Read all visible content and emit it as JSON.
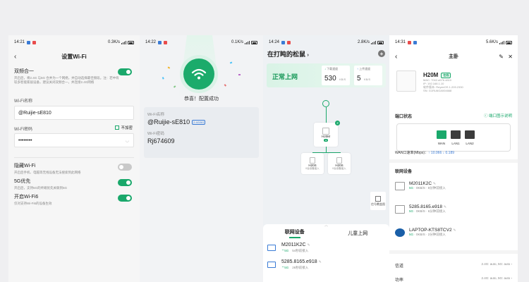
{
  "panel1": {
    "status": {
      "time": "14:21",
      "speed": "0.3K/s",
      "battery": "77"
    },
    "title": "设置Wi-Fi",
    "dualband": {
      "label": "双频合一",
      "desc": "开启后，将2.4G 与5G 合并为一个网络，并自动选择最佳频段。注：若中有较多智能家居设备，建议关闭双频合一，并连接2.4G网络",
      "on": true
    },
    "wifiname_label": "Wi-Fi名称",
    "wifiname_value": "@Ruijie-sE810",
    "password_label": "Wi-Fi密码",
    "hide_password_label": "不加密",
    "password_value": "••••••••",
    "hidden": {
      "label": "隐藏Wi-Fi",
      "desc": "开启后手机、电脑等无线设备无法搜索到此网络",
      "on": false
    },
    "fiveg": {
      "label": "5G优先",
      "desc": "开启后，支持5G的终端优先关联到5G",
      "on": true
    },
    "wifi6": {
      "label": "开启Wi-Fi6",
      "desc": "仅对支持Wi-Fi6的设备生效",
      "on": true
    }
  },
  "panel2": {
    "status": {
      "time": "14:22",
      "speed": "0.1K/s",
      "battery": "77"
    },
    "success_text": "恭喜！配置成功",
    "name_label": "Wi-Fi名称",
    "name_value": "@Ruijie-sE810",
    "band_tag": "2.4G/5G",
    "pwd_label": "Wi-Fi密码",
    "pwd_value": "Rj674609"
  },
  "panel3": {
    "status": {
      "time": "14:24",
      "speed": "2.8K/s",
      "battery": "77"
    },
    "title": "在打盹的松鼠",
    "net_status": "正常上网",
    "down_label": "下载速度",
    "down_value": "530",
    "down_unit": "KB/S",
    "up_label": "上传速度",
    "up_value": "5",
    "up_unit": "KB/S",
    "main_node": "H20M",
    "main_badge": "2",
    "node1": "H20S",
    "node1_sub": "0台设备接入",
    "node2": "H20S",
    "node2_sub": "0台设备接入",
    "ota_label": "信号覆盖图",
    "tab_active": "联网设备",
    "tab_other": "儿童上网",
    "devices": [
      {
        "name": "M2011K2C",
        "band": "5G",
        "meta": "54秒前接入"
      },
      {
        "name": "5285.8165.e918",
        "band": "5G",
        "meta": "26秒前接入"
      }
    ]
  },
  "panel4": {
    "status": {
      "time": "14:31",
      "speed": "5.6K/s",
      "battery": "77"
    },
    "title": "主卧",
    "router_name": "H20M",
    "router_tag": "在线",
    "router_meta": [
      "MAC: 7042.a576.4810",
      "IP: 192.168.1.10",
      "软件版本: ReyeeOS 1.209.2330",
      "SN: G1RU6GA004668"
    ],
    "port_section": "端口状态",
    "port_link": "端口图示说明",
    "ports": [
      "WAN",
      "LAN1",
      "LAN2"
    ],
    "wan_rate_label": "WAN口速率(Mbps)：",
    "wan_rate_value": "↑ 10.066 ↓ 0.189",
    "device_section": "联网设备",
    "devices": [
      {
        "name": "M2011K2C",
        "band": "5G",
        "speed": "0KB/S",
        "meta": "8分钟前接入"
      },
      {
        "name": "5285.8165.e918",
        "band": "5G",
        "speed": "0KB/S",
        "meta": "6分钟前接入"
      },
      {
        "name": "LAPTOP-KTS8TCV2",
        "band": "5G",
        "speed": "0KB/S",
        "meta": "2分钟前接入"
      }
    ],
    "channel_label": "信道",
    "channel_value": "2.4G: auto, 5G: auto",
    "power_label": "功率",
    "power_value": "2.4G: auto, 5G: auto"
  },
  "colors": {
    "accent": "#1aa86b",
    "link": "#3a7bd5"
  }
}
